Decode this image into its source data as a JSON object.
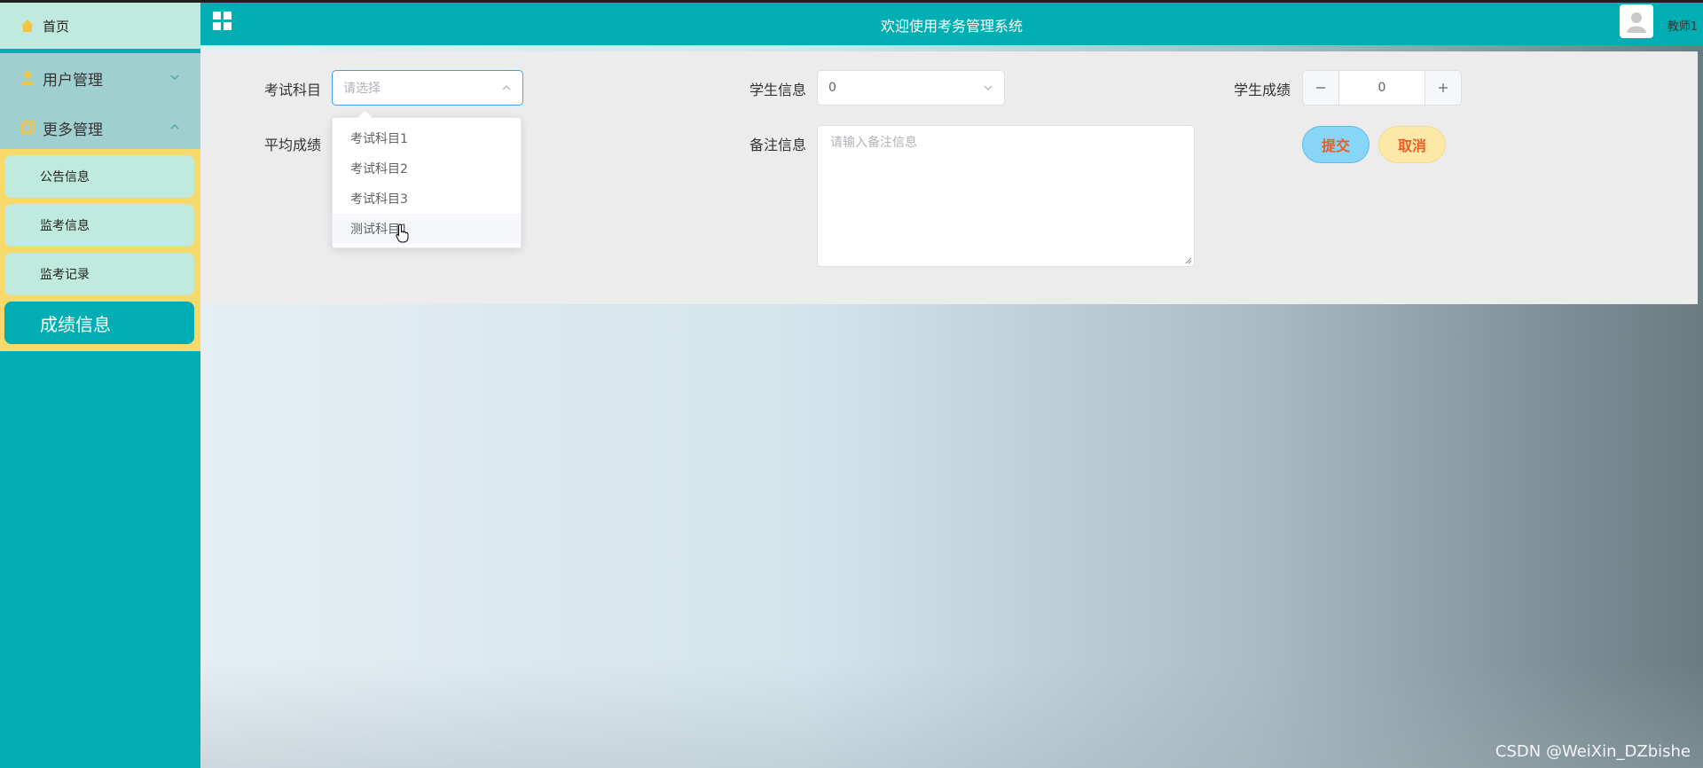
{
  "header": {
    "title": "欢迎使用考务管理系统",
    "username": "教师1"
  },
  "sidebar": {
    "home": "首页",
    "menus": [
      {
        "label": "用户管理",
        "expanded": false
      },
      {
        "label": "更多管理",
        "expanded": true
      }
    ],
    "submenu": [
      "公告信息",
      "监考信息",
      "监考记录",
      "成绩信息"
    ],
    "active": "成绩信息"
  },
  "form": {
    "subject_label": "考试科目",
    "subject_placeholder": "请选择",
    "student_label": "学生信息",
    "student_value": "0",
    "score_label": "学生成绩",
    "score_value": "0",
    "avg_label": "平均成绩",
    "remark_label": "备注信息",
    "remark_placeholder": "请输入备注信息",
    "submit": "提交",
    "cancel": "取消"
  },
  "dropdown": {
    "options": [
      "考试科目1",
      "考试科目2",
      "考试科目3",
      "测试科目1"
    ],
    "hovered_index": 3
  },
  "watermark": "CSDN @WeiXin_DZbishe",
  "colors": {
    "primary": "#00aeb3",
    "submenu_bg": "#f6d96a",
    "item_bg": "#bfeadd",
    "accent_text": "#ee5b25"
  }
}
